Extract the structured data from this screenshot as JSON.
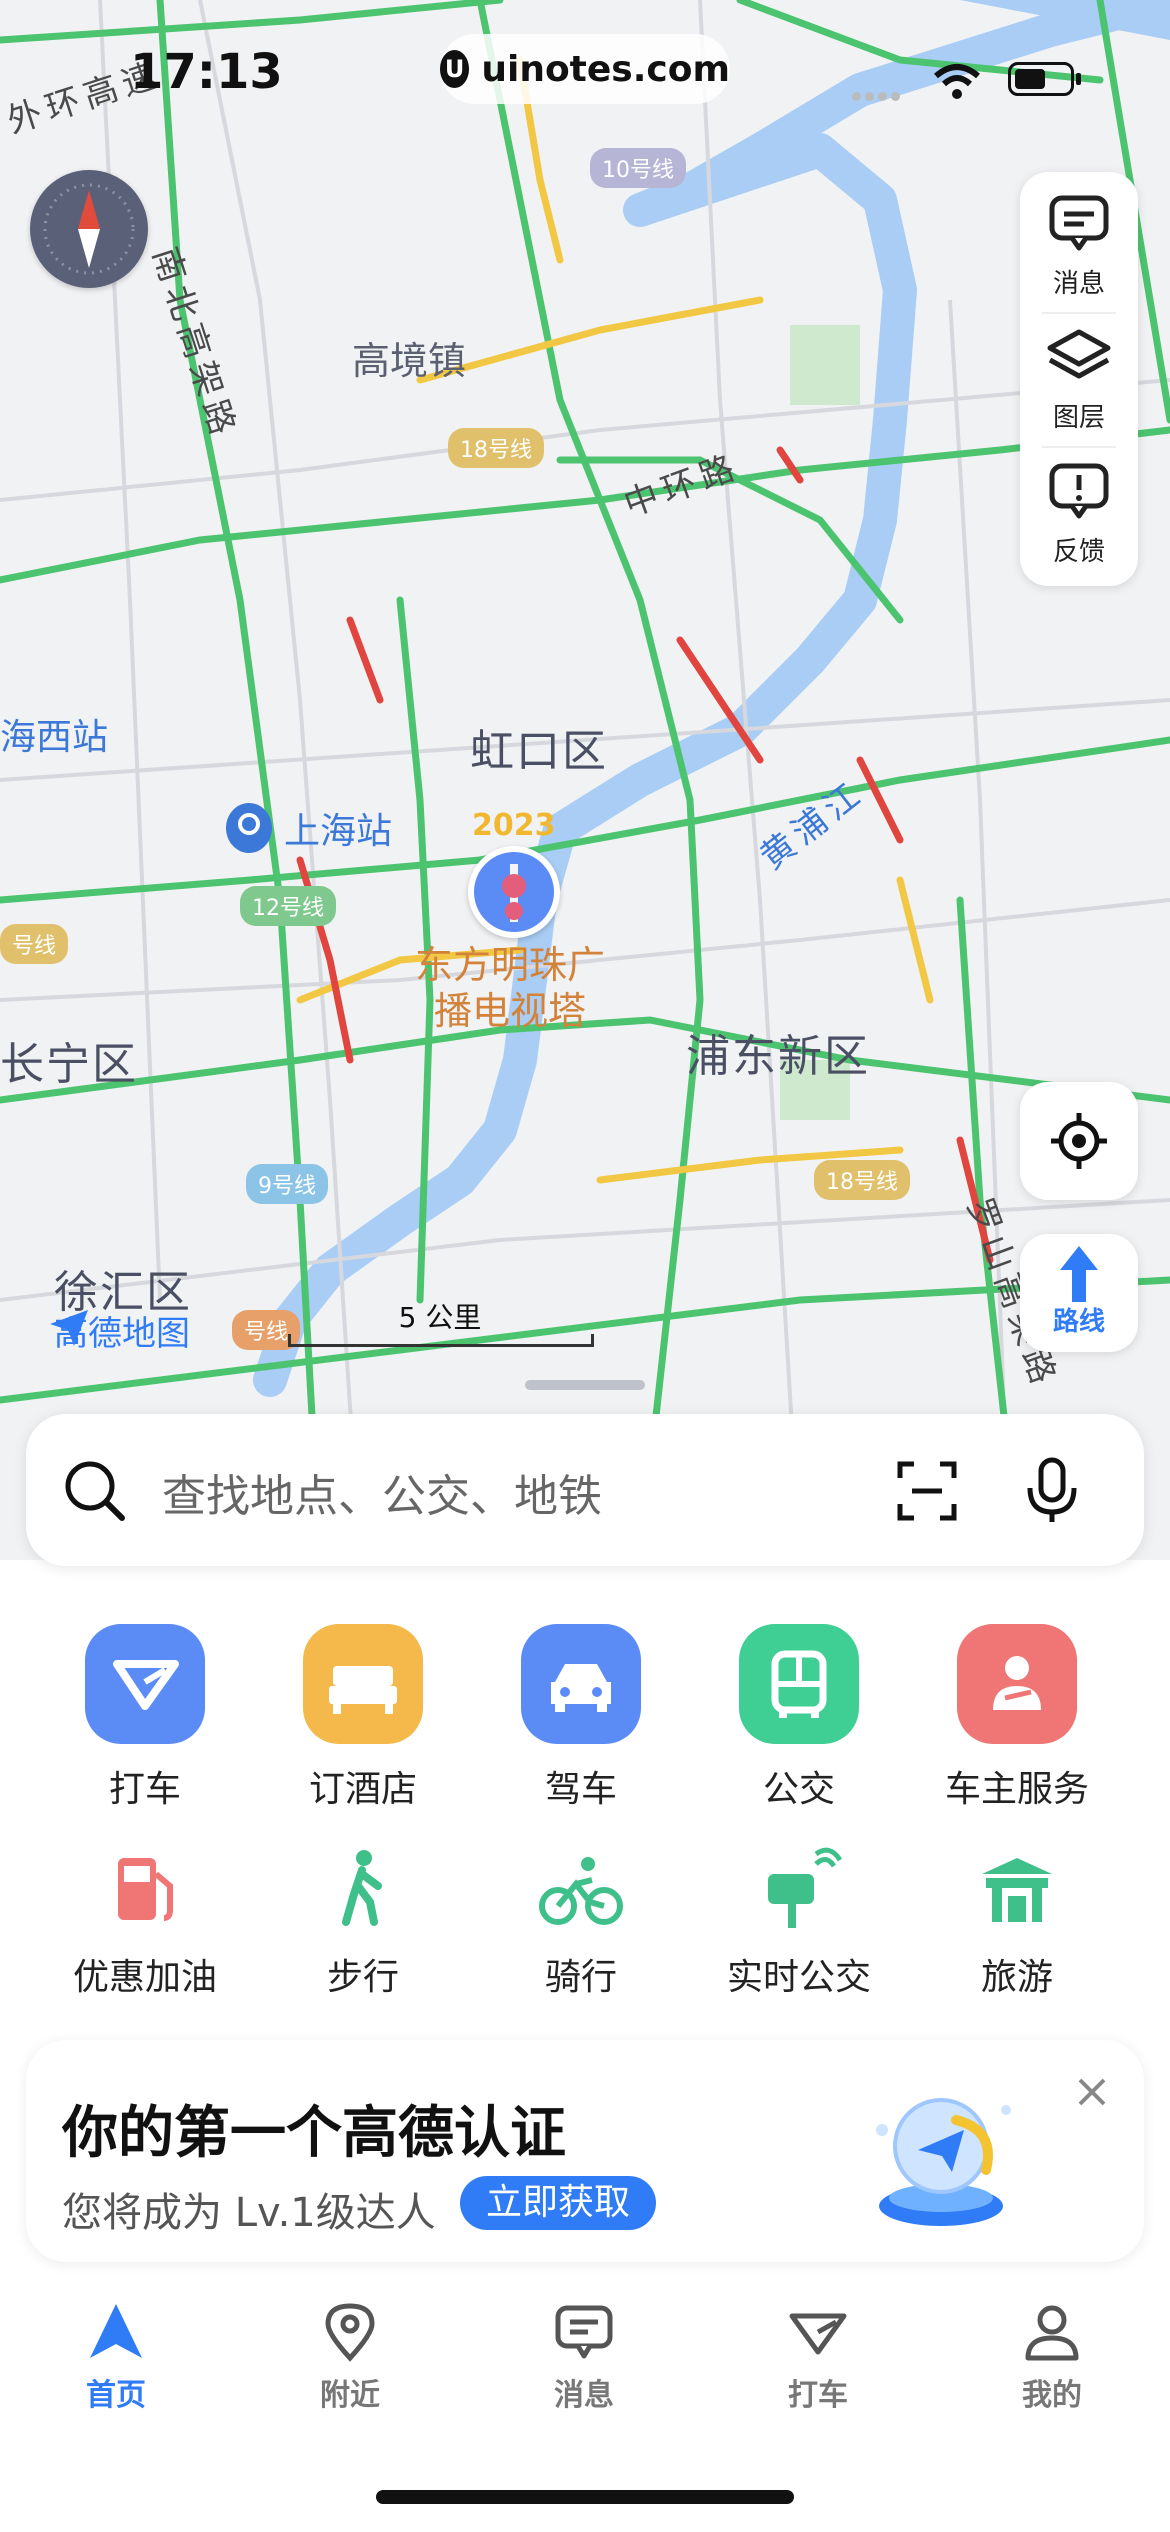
{
  "status_bar": {
    "time": "17:13",
    "url": "uinotes.com"
  },
  "map": {
    "districts": [
      "虹口区",
      "浦东新区",
      "长宁区",
      "徐汇区"
    ],
    "places": [
      "高境镇"
    ],
    "stations": [
      "上海站",
      "海西站"
    ],
    "roads": [
      "外环高速",
      "南北高架路",
      "中环路",
      "黄浦江",
      "罗山高架路"
    ],
    "metro_lines": [
      "10号线",
      "18号线",
      "12号线",
      "9号线",
      "18号线",
      "号线",
      "号线"
    ],
    "landmark": {
      "name_line1": "东方明珠广",
      "name_line2": "播电视塔",
      "badge": "2023"
    },
    "scale_label": "5 公里",
    "brand": "高德地图"
  },
  "right_panel": {
    "items": [
      {
        "label": "消息",
        "icon": "message-icon"
      },
      {
        "label": "图层",
        "icon": "layers-icon"
      },
      {
        "label": "反馈",
        "icon": "feedback-icon"
      }
    ],
    "locate_icon": "locate-icon",
    "route_label": "路线"
  },
  "search": {
    "placeholder": "查找地点、公交、地铁",
    "scan_icon": "scan-icon",
    "mic_icon": "mic-icon"
  },
  "quick_services": [
    {
      "label": "打车",
      "color": "#5b8cf6"
    },
    {
      "label": "订酒店",
      "color": "#f4b84b"
    },
    {
      "label": "驾车",
      "color": "#5b8cf6"
    },
    {
      "label": "公交",
      "color": "#3fcf95"
    },
    {
      "label": "车主服务",
      "color": "#f07575"
    }
  ],
  "secondary_services": [
    {
      "label": "优惠加油",
      "color": "#f07575"
    },
    {
      "label": "步行",
      "color": "#3fc08a"
    },
    {
      "label": "骑行",
      "color": "#3fc08a"
    },
    {
      "label": "实时公交",
      "color": "#3fc08a"
    },
    {
      "label": "旅游",
      "color": "#3fc08a"
    }
  ],
  "cert_card": {
    "title": "你的第一个高德认证",
    "subtitle": "您将成为 Lv.1级达人",
    "button": "立即获取"
  },
  "tabbar": [
    {
      "label": "首页",
      "active": true
    },
    {
      "label": "附近",
      "active": false
    },
    {
      "label": "消息",
      "active": false
    },
    {
      "label": "打车",
      "active": false
    },
    {
      "label": "我的",
      "active": false
    }
  ],
  "colors": {
    "accent": "#2f7cf6",
    "river": "#a9cdf5",
    "traffic_green": "#4cc46f",
    "traffic_yellow": "#f2c744",
    "traffic_red": "#e0463f"
  }
}
